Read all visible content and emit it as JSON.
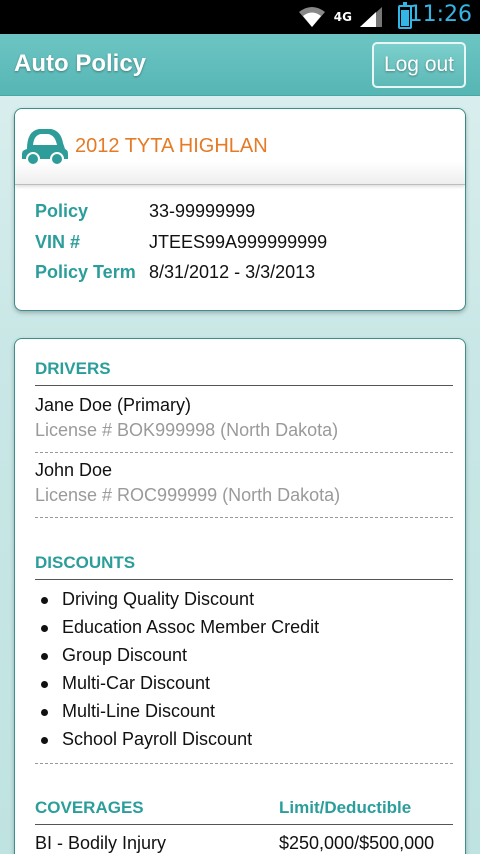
{
  "status_bar": {
    "network": "4G",
    "time": "11:26"
  },
  "action_bar": {
    "title": "Auto Policy",
    "logout_label": "Log out"
  },
  "vehicle": {
    "name": "2012 TYTA HIGHLAN",
    "icon": "car-icon",
    "policy_label": "Policy",
    "policy_value": "33-99999999",
    "vin_label": "VIN #",
    "vin_value": "JTEES99A999999999",
    "term_label": "Policy Term",
    "term_value": "8/31/2012 - 3/3/2013"
  },
  "drivers": {
    "heading": "DRIVERS",
    "items": [
      {
        "name": "Jane Doe (Primary)",
        "license": "License # BOK999998 (North Dakota)"
      },
      {
        "name": "John Doe",
        "license": "License # ROC999999 (North Dakota)"
      }
    ]
  },
  "discounts": {
    "heading": "DISCOUNTS",
    "items": [
      "Driving Quality Discount",
      "Education Assoc Member Credit",
      "Group Discount",
      "Multi-Car Discount",
      "Multi-Line Discount",
      "School Payroll Discount"
    ]
  },
  "coverages": {
    "heading": "COVERAGES",
    "limit_heading": "Limit/Deductible",
    "items": [
      {
        "name": "BI - Bodily Injury",
        "limit": "$250,000/$500,000"
      }
    ]
  },
  "colors": {
    "accent_teal": "#2b9e9b",
    "vehicle_orange": "#e57b25",
    "actionbar": "#5dbab8",
    "time_blue": "#33b5e5"
  }
}
